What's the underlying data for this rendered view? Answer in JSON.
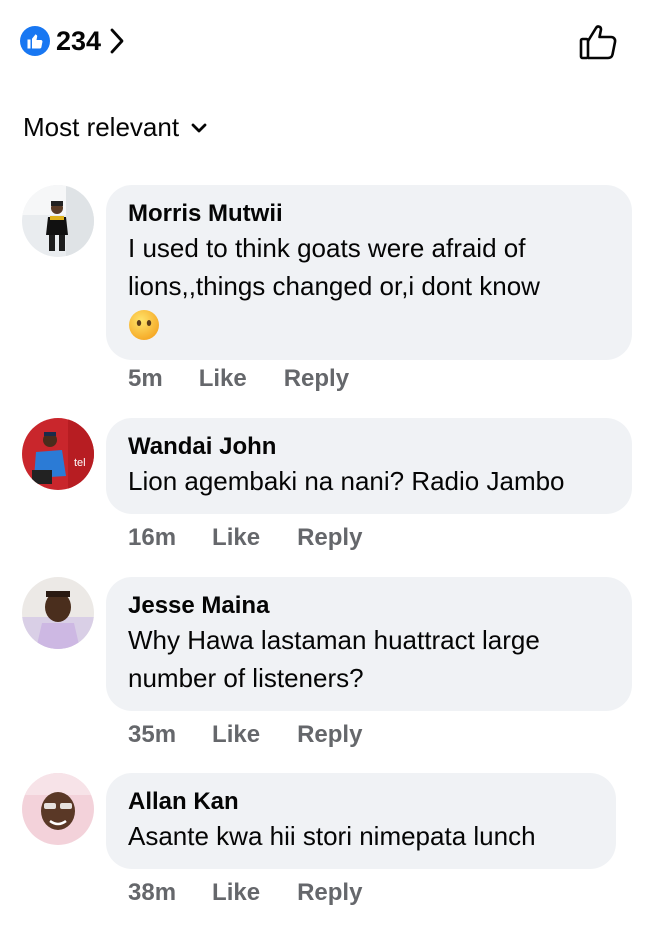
{
  "reactions": {
    "count": "234",
    "icon": "like-badge-icon",
    "color": "#1877F2"
  },
  "sort": {
    "label": "Most relevant"
  },
  "actions": {
    "like": "Like",
    "reply": "Reply"
  },
  "comments": [
    {
      "author": "Morris Mutwii",
      "text": "I used to think goats were afraid of lions,,things changed or,i dont know",
      "emoji": "😶",
      "time": "5m"
    },
    {
      "author": "Wandai John",
      "text": "Lion agembaki na nani? Radio Jambo",
      "time": "16m"
    },
    {
      "author": "Jesse Maina",
      "text": "Why Hawa lastaman huattract large number of listeners?",
      "time": "35m"
    },
    {
      "author": "Allan Kan",
      "text": "Asante kwa hii stori nimepata lunch",
      "time": "38m"
    }
  ],
  "colors": {
    "bubble": "#F0F2F5",
    "meta": "#65676B",
    "accent": "#1877F2"
  }
}
